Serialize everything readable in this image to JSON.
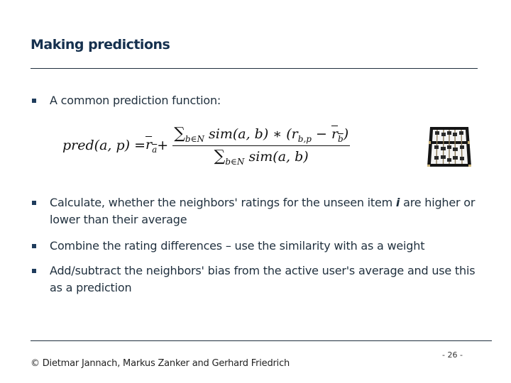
{
  "slide": {
    "title": "Making predictions",
    "bullets": [
      {
        "text": "A common prediction function:"
      },
      {
        "text_before": "Calculate, whether the neighbors' ratings for the unseen item ",
        "italic": "i",
        "text_after": " are higher or lower than their average"
      },
      {
        "text": "Combine the rating differences – use the similarity with as a weight"
      },
      {
        "text": "Add/subtract the  neighbors' bias from the active user's average and use this as a prediction"
      }
    ],
    "formula": {
      "lhs": "pred(a, p) = ",
      "mean_a": "r",
      "mean_a_sub": "a",
      "plus": " +",
      "numerator_sum": "∑",
      "numerator_sum_sub": "b∈N",
      "numerator_body_1": " sim(a, b) ∗ (r",
      "numerator_body_sub": "b,p",
      "numerator_body_2": " − ",
      "numerator_mean": "r",
      "numerator_mean_sub": "b",
      "numerator_close": ")",
      "denominator_sum": "∑",
      "denominator_sum_sub": "b∈N",
      "denominator_body": " sim(a, b)"
    },
    "image": {
      "icon": "abacus-icon"
    },
    "footer": {
      "copyright": "© Dietmar Jannach, Markus Zanker and Gerhard Friedrich",
      "page": "- 26 -"
    }
  }
}
